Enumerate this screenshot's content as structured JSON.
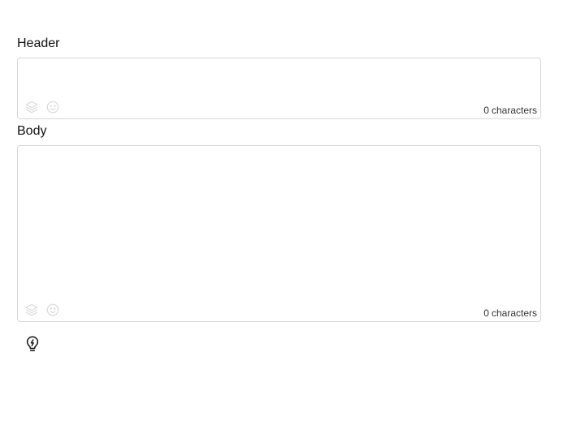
{
  "fields": {
    "header": {
      "label": "Header",
      "value": "",
      "count": "0",
      "count_unit": "characters"
    },
    "body": {
      "label": "Body",
      "value": "",
      "count": "0",
      "count_unit": "characters"
    }
  },
  "icons": {
    "layers": "layers-icon",
    "emoji": "emoji-icon",
    "bulb": "lightbulb-bolt-icon"
  },
  "colors": {
    "border": "#d6d6d6",
    "icon_muted": "#d9d9d9",
    "text": "#111111"
  }
}
